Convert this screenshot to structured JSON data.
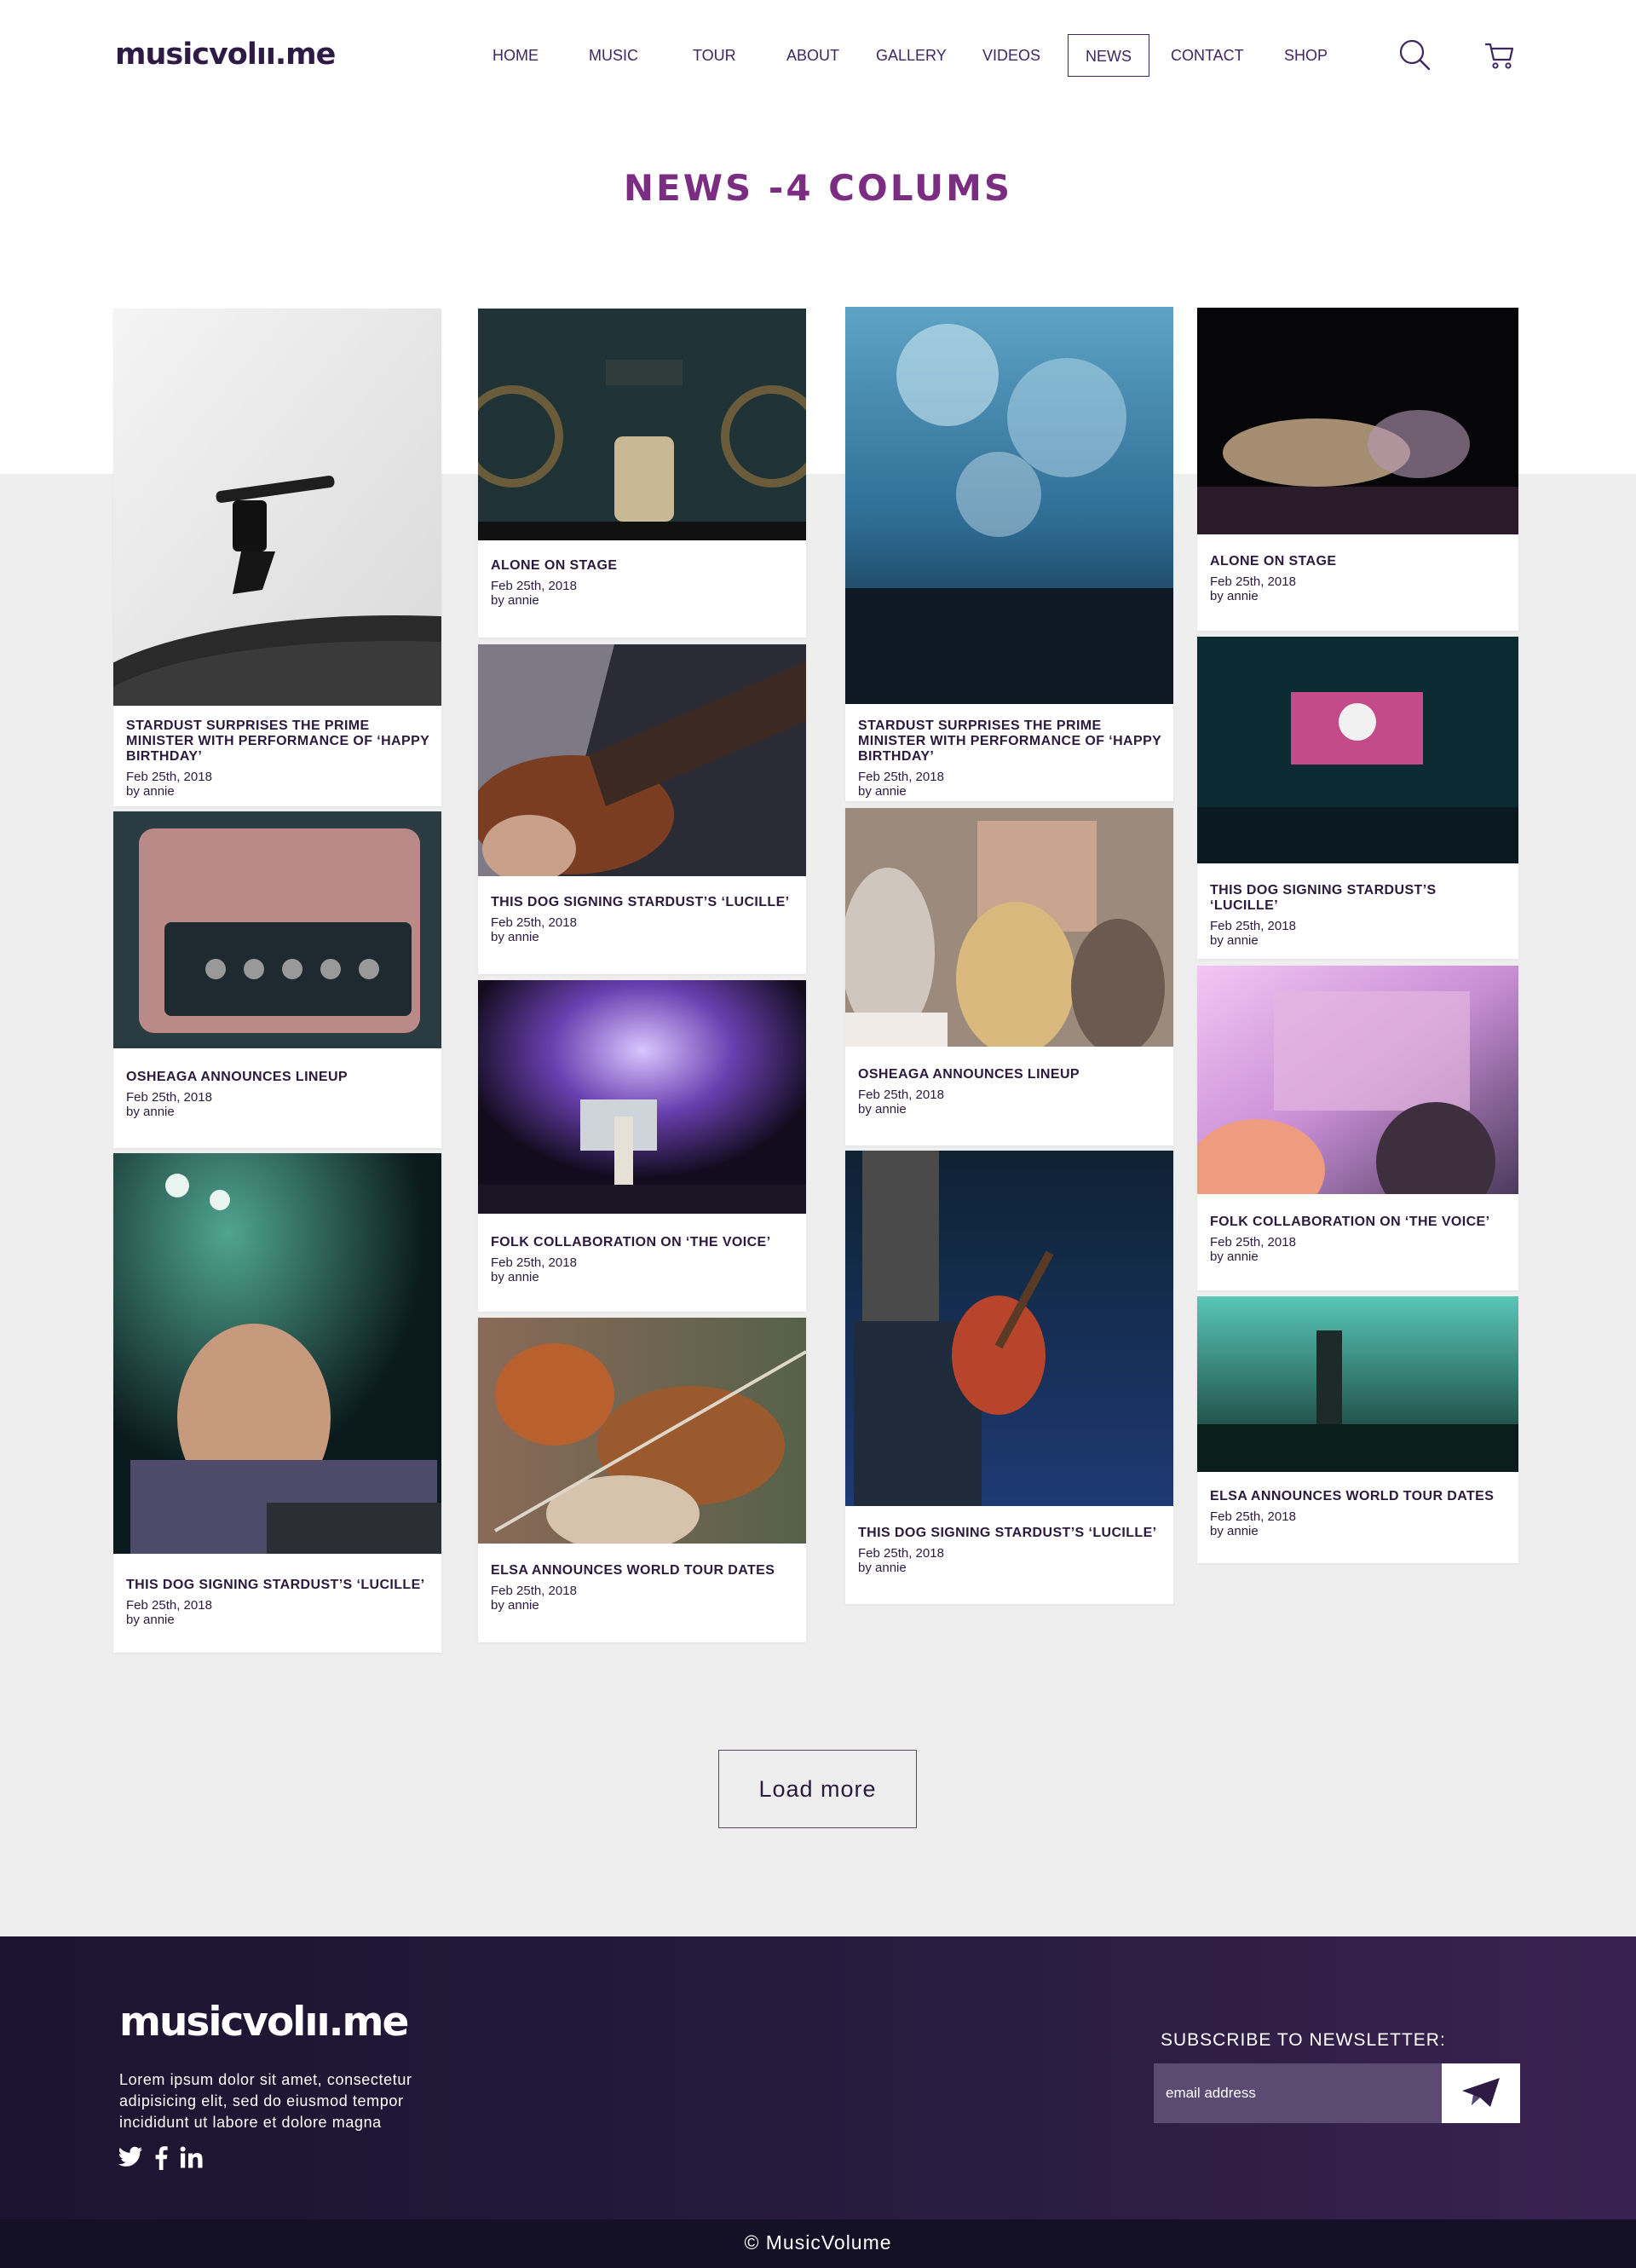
{
  "header": {
    "logo": "musicvolıı.me",
    "nav": [
      "HOME",
      "MUSIC",
      "TOUR",
      "ABOUT",
      "GALLERY",
      "VIDEOS",
      "NEWS",
      "CONTACT",
      "SHOP"
    ],
    "active_nav": "NEWS",
    "icons": [
      "search-icon",
      "cart-icon"
    ]
  },
  "page_title": "NEWS -4 COLUMS",
  "cards": [
    {
      "title": "STARDUST SURPRISES THE PRIME MINISTER WITH PERFORMANCE OF ‘HAPPY BIRTHDAY’",
      "date": "Feb 25th, 2018",
      "author": "by annie",
      "image": "turntable-photo"
    },
    {
      "title": "OSHEAGA ANNOUNCES LINEUP",
      "date": "Feb 25th, 2018",
      "author": "by annie",
      "image": "amplifier-photo"
    },
    {
      "title": "THIS DOG SIGNING STARDUST’S ‘LUCILLE’",
      "date": "Feb 25th, 2018",
      "author": "by annie",
      "image": "dj-photo"
    },
    {
      "title": "ALONE ON STAGE",
      "date": "Feb 25th, 2018",
      "author": "by annie",
      "image": "mason-jar-photo"
    },
    {
      "title": "THIS DOG SIGNING STARDUST’S ‘LUCILLE’",
      "date": "Feb 25th, 2018",
      "author": "by annie",
      "image": "guitar-closeup-photo"
    },
    {
      "title": "FOLK COLLABORATION ON ‘THE VOICE’",
      "date": "Feb 25th, 2018",
      "author": "by annie",
      "image": "stage-lights-photo"
    },
    {
      "title": "ELSA ANNOUNCES WORLD TOUR DATES",
      "date": "Feb 25th, 2018",
      "author": "by annie",
      "image": "violin-photo"
    },
    {
      "title": "STARDUST SURPRISES THE PRIME MINISTER WITH PERFORMANCE OF ‘HAPPY BIRTHDAY’",
      "date": "Feb 25th, 2018",
      "author": "by annie",
      "image": "confetti-crowd-photo"
    },
    {
      "title": "OSHEAGA ANNOUNCES LINEUP",
      "date": "Feb 25th, 2018",
      "author": "by annie",
      "image": "festival-crowd-photo"
    },
    {
      "title": "THIS DOG SIGNING STARDUST’S ‘LUCILLE’",
      "date": "Feb 25th, 2018",
      "author": "by annie",
      "image": "guitarist-photo"
    },
    {
      "title": "ALONE ON STAGE",
      "date": "Feb 25th, 2018",
      "author": "by annie",
      "image": "concert-crowd-photo"
    },
    {
      "title": "THIS DOG SIGNING STARDUST’S ‘LUCILLE’",
      "date": "Feb 25th, 2018",
      "author": "by annie",
      "image": "dj-screen-photo"
    },
    {
      "title": "FOLK COLLABORATION ON ‘THE VOICE’",
      "date": "Feb 25th, 2018",
      "author": "by annie",
      "image": "bokeh-crowd-photo"
    },
    {
      "title": "ELSA ANNOUNCES WORLD TOUR DATES",
      "date": "Feb 25th, 2018",
      "author": "by annie",
      "image": "singer-stage-photo"
    }
  ],
  "load_more": "Load more",
  "footer": {
    "logo": "musicvolıı.me",
    "description": "Lorem ipsum dolor sit amet, consectetur adipisicing elit, sed do eiusmod tempor incididunt ut labore et dolore magna",
    "social": [
      "twitter-icon",
      "facebook-icon",
      "linkedin-icon"
    ],
    "subscribe_title": "SUBSCRIBE TO NEWSLETTER:",
    "email_placeholder": "email address",
    "copyright": "© MusicVolume"
  },
  "colors": {
    "brand_purple": "#7b2d82",
    "nav_text": "#3e2660",
    "footer_bg": "#241a3b",
    "page_bg": "#eeeeee"
  }
}
